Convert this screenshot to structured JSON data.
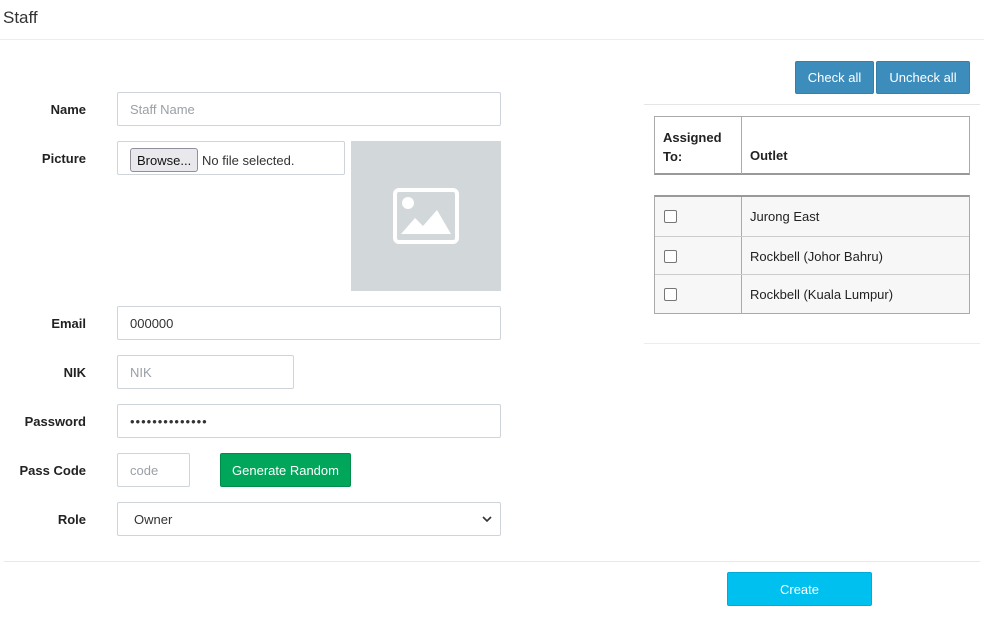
{
  "page": {
    "title": "Staff"
  },
  "form": {
    "name": {
      "label": "Name",
      "placeholder": "Staff Name",
      "value": ""
    },
    "picture": {
      "label": "Picture",
      "browse_label": "Browse...",
      "file_status": "No file selected."
    },
    "email": {
      "label": "Email",
      "value": "000000"
    },
    "nik": {
      "label": "NIK",
      "placeholder": "NIK",
      "value": ""
    },
    "password": {
      "label": "Password",
      "value": "••••••••••••••"
    },
    "pass_code": {
      "label": "Pass Code",
      "placeholder": "code",
      "generate_label": "Generate Random"
    },
    "role": {
      "label": "Role",
      "selected": "Owner"
    }
  },
  "assignment": {
    "check_all_label": "Check all",
    "uncheck_all_label": "Uncheck all",
    "columns": {
      "assigned": "Assigned To:",
      "outlet": "Outlet"
    },
    "rows": [
      {
        "outlet": "Jurong East",
        "checked": false
      },
      {
        "outlet": "Rockbell (Johor Bahru)",
        "checked": false
      },
      {
        "outlet": "Rockbell (Kuala Lumpur)",
        "checked": false
      }
    ]
  },
  "actions": {
    "create_label": "Create"
  },
  "colors": {
    "primary": "#3c8dbc",
    "success": "#00a65a",
    "info": "#00c0ef",
    "placeholder_bg": "#d2d7da"
  },
  "icons": {
    "picture_placeholder": "image-icon",
    "role_dropdown": "chevron-down-icon"
  }
}
